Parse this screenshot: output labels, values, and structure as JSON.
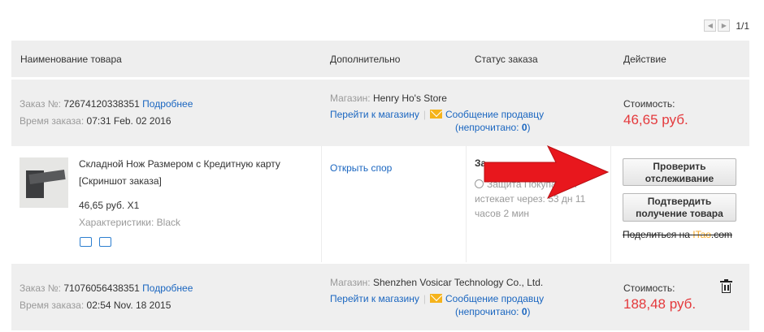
{
  "pager": {
    "prev_icon": "chevron-left-icon",
    "next_icon": "chevron-right-icon",
    "count": "1/1"
  },
  "table_header": {
    "product": "Наименование товара",
    "additional": "Дополнительно",
    "status": "Статус заказа",
    "action": "Действие"
  },
  "orders": [
    {
      "order_label": "Заказ №:",
      "order_number": "72674120338351",
      "details_link": "Подробнее",
      "time_label": "Время заказа:",
      "time_value": "07:31 Feb. 02 2016",
      "store_label": "Магазин:",
      "store_name": "Henry Ho's Store",
      "go_to_store": "Перейти к магазину",
      "separator": "|",
      "message_seller": "Сообщение продавцу",
      "unread_prefix": "(непрочитано:",
      "unread_count": "0",
      "unread_suffix": ")",
      "cost_label": "Стоимость:",
      "cost_value": "46,65 руб."
    },
    {
      "order_label": "Заказ №:",
      "order_number": "71076056438351",
      "details_link": "Подробнее",
      "time_label": "Время заказа:",
      "time_value": "02:54 Nov. 18 2015",
      "store_label": "Магазин:",
      "store_name": "Shenzhen Vosicar Technology Co., Ltd.",
      "go_to_store": "Перейти к магазину",
      "separator": "|",
      "message_seller": "Сообщение продавцу",
      "unread_prefix": "(непрочитано:",
      "unread_count": "0",
      "unread_suffix": ")",
      "cost_label": "Стоимость:",
      "cost_value": "188,48 руб."
    }
  ],
  "item": {
    "title": "Складной Нож Размером с Кредитную карту",
    "snapshot": "[Скриншот заказа]",
    "price_qty": "46,65 руб. X1",
    "characteristics": "Характеристики: Black",
    "open_dispute": "Открыть спор",
    "status_partial": "За",
    "protection_partial": "Защита Покупателя",
    "expires_line1": "истекает через: 53 дн 11",
    "expires_line2": "часов 2 мин",
    "check_tracking_line1": "Проверить",
    "check_tracking_line2": "отслеживание",
    "confirm_line1": "Подтвердить",
    "confirm_line2": "получение товара",
    "share_prefix": "Поделиться на ",
    "share_brand": "ITao",
    "share_suffix": ".com"
  },
  "colors": {
    "link": "#1a66c0",
    "price": "#e4393c",
    "arrow": "#e8171d",
    "header_bg": "#eeeeee"
  },
  "icons": {
    "mail": "mail-icon",
    "truck": "truck-icon",
    "return": "return-icon",
    "trash": "trash-icon",
    "arrow": "red-arrow-annotation"
  }
}
